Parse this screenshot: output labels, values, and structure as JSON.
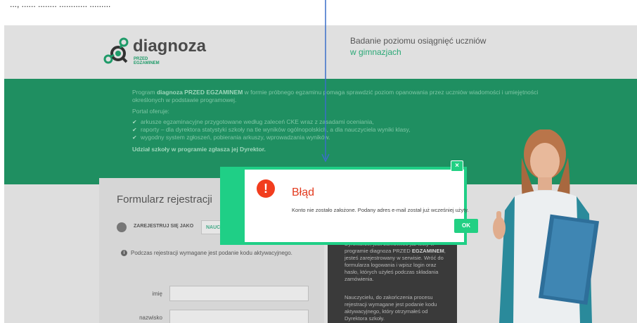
{
  "top_caption": "..., ...... ........ ............ .........",
  "header": {
    "logo_word": "diagnoza",
    "logo_sub_line1": "PRZED",
    "logo_sub_line2": "EGZAMINEM",
    "tagline_line1": "Badanie poziomu osiągnięć uczniów",
    "tagline_line2": "w gimnazjach"
  },
  "banner": {
    "intro_prefix": "Program ",
    "intro_bold": "diagnoza PRZED EGZAMINEM",
    "intro_suffix": " w formie próbnego egzaminu pomaga sprawdzić poziom opanowania przez uczniów wiadomości i umiejętności określonych w podstawie programowej.",
    "offers_label": "Portal oferuje:",
    "items": [
      "arkusze egzaminacyjne przygotowane według zaleceń CKE wraz z zasadami oceniania,",
      "raporty – dla dyrektora statystyki szkoły na tle wyników ogólnopolskich, a dla nauczyciela wyniki klasy,",
      "wygodny system zgłoszeń, pobierania arkuszy, wprowadzania wyników."
    ],
    "participation": "Udział szkoły w programie zgłasza jej Dyrektor."
  },
  "form": {
    "title": "Formularz rejestracji",
    "register_as_label": "ZAREJESTRUJ SIĘ JAKO",
    "register_as_option": "NAUC",
    "info_text": "Podczas rejestracji wymagane jest podanie kodu aktywacyjnego.",
    "fields": [
      {
        "label": "imię",
        "value": ""
      },
      {
        "label": "nazwisko",
        "value": ""
      }
    ]
  },
  "side_panel": {
    "para1_prefix": "Dyrektorze, jeśli zamówiłeś już testy w programie diagnoza PRZED ",
    "para1_bold": "EGZAMINEM",
    "para1_suffix": ", jesteś zarejestrowany w serwisie. Wróć do formularza logowania i wpisz login oraz hasło, których użyłeś podczas składania zamówienia.",
    "para2": "Nauczycielu, do zakończenia procesu rejestracji wymagane jest podanie kodu aktywacyjnego, który otrzymałeś od Dyrektora szkoły."
  },
  "modal": {
    "icon": "exclamation-icon",
    "title": "Błąd",
    "message": "Konto nie zostało założone. Podany adres e-mail został już wcześniej użyty.",
    "ok_label": "OK",
    "close_label": "×"
  },
  "colors": {
    "accent_green": "#1fcf86",
    "banner_green": "#1f8f61",
    "error_red": "#f23d1e",
    "annotation_blue": "#3a6fc9"
  }
}
